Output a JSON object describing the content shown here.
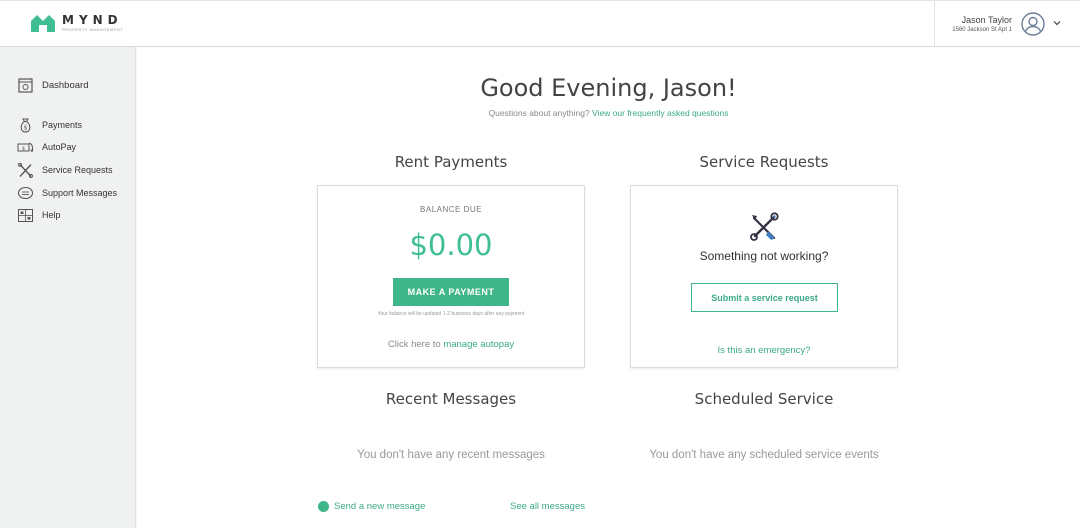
{
  "app": {
    "brand": "MYND",
    "brand_sub": "PROPERTY MANAGEMENT",
    "accent_color": "#3fb68a"
  },
  "user": {
    "name": "Jason Taylor",
    "address": "1560 Jackson St Apt 1",
    "avatar_icon": "user-circle-icon",
    "menu_icon": "chevron-down-icon"
  },
  "sidebar": {
    "items": [
      {
        "label": "Dashboard",
        "icon": "dashboard-icon",
        "active": true
      },
      {
        "label": "Payments",
        "icon": "money-bag-icon"
      },
      {
        "label": "AutoPay",
        "icon": "autopay-icon"
      },
      {
        "label": "Service Requests",
        "icon": "tools-icon"
      },
      {
        "label": "Support Messages",
        "icon": "chat-bubble-icon"
      },
      {
        "label": "Help",
        "icon": "help-grid-icon"
      }
    ]
  },
  "main": {
    "greeting": "Good Evening, Jason!",
    "questions_text": "Questions about anything?",
    "faq_link": "View our frequently asked questions",
    "rent": {
      "title": "Rent Payments",
      "balance_label": "BALANCE DUE",
      "balance_amount": "$0.00",
      "pay_button": "MAKE A PAYMENT",
      "note": "Your balance will be updated 1-2 business days after any payment",
      "autopay_prefix": "Click here to",
      "autopay_link": "manage autopay"
    },
    "service": {
      "title": "Service Requests",
      "icon": "wrench-screwdriver-icon",
      "question": "Something not working?",
      "submit_button": "Submit a service request",
      "emergency_link": "Is this an emergency?"
    },
    "messages": {
      "title": "Recent Messages",
      "empty_text": "You don't have any recent messages",
      "send_link": "Send a new message",
      "see_all_link": "See all messages"
    },
    "scheduled": {
      "title": "Scheduled Service",
      "empty_text": "You don't have any scheduled service events"
    }
  }
}
